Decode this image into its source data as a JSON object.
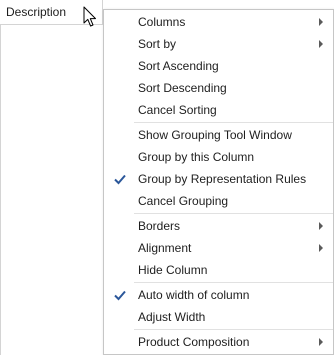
{
  "grid": {
    "column_header": "Description"
  },
  "icons": {
    "cursor": "mouse-pointer-icon",
    "check": "checkmark-icon",
    "submenu": "chevron-right-icon"
  },
  "colors": {
    "check": "#2b579a",
    "text": "#1e1e1e",
    "separator": "#e1e1e1",
    "border": "#c6c6c6"
  },
  "menu": {
    "columns": "Columns",
    "sort_by": "Sort by",
    "sort_ascending": "Sort Ascending",
    "sort_descending": "Sort Descending",
    "cancel_sorting": "Cancel Sorting",
    "show_grouping_tool_window": "Show Grouping Tool Window",
    "group_by_this_column": "Group by this Column",
    "group_by_representation_rules": "Group by Representation Rules",
    "cancel_grouping": "Cancel Grouping",
    "borders": "Borders",
    "alignment": "Alignment",
    "hide_column": "Hide Column",
    "auto_width_of_column": "Auto width of column",
    "adjust_width": "Adjust Width",
    "product_composition": "Product Composition"
  },
  "state": {
    "group_by_representation_rules_checked": true,
    "auto_width_of_column_checked": true
  }
}
